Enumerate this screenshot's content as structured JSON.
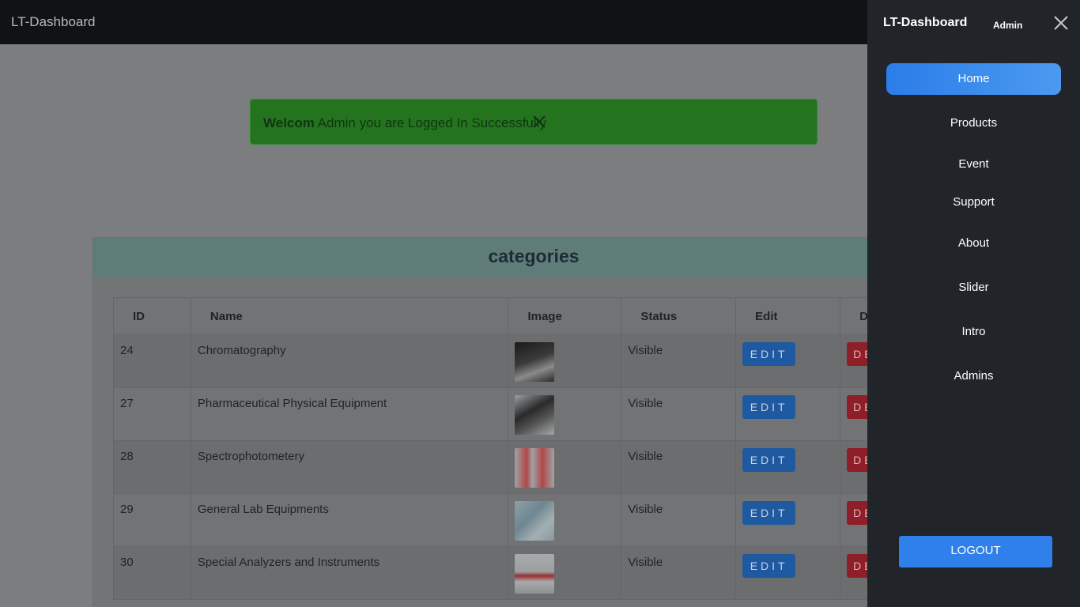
{
  "app": {
    "brand": "LT-Dashboard"
  },
  "alert": {
    "strong": "Welcom",
    "message": " Admin you are Logged In Successfully",
    "close_icon": "close-icon"
  },
  "card": {
    "title": "categories",
    "columns": [
      "ID",
      "Name",
      "Image",
      "Status",
      "Edit",
      "D"
    ],
    "rows": [
      {
        "id": "24",
        "name": "Chromatography",
        "status": "Visible",
        "edit": "EDIT",
        "delete": "DE"
      },
      {
        "id": "27",
        "name": "Pharmaceutical Physical Equipment",
        "status": "Visible",
        "edit": "EDIT",
        "delete": "DE"
      },
      {
        "id": "28",
        "name": "Spectrophotometery",
        "status": "Visible",
        "edit": "EDIT",
        "delete": "DE"
      },
      {
        "id": "29",
        "name": "General Lab Equipments",
        "status": "Visible",
        "edit": "EDIT",
        "delete": "DE"
      },
      {
        "id": "30",
        "name": "Special Analyzers and Instruments",
        "status": "Visible",
        "edit": "EDIT",
        "delete": "DE"
      }
    ]
  },
  "sidebar": {
    "brand": "LT-Dashboard",
    "user": "Admin",
    "items": [
      {
        "label": "Home",
        "active": true
      },
      {
        "label": "Products",
        "active": false
      },
      {
        "label": "Event",
        "active": false
      },
      {
        "label": "Support",
        "active": false
      },
      {
        "label": "About",
        "active": false
      },
      {
        "label": "Slider",
        "active": false
      },
      {
        "label": "Intro",
        "active": false
      },
      {
        "label": "Admins",
        "active": false
      }
    ],
    "logout": "LOGOUT"
  },
  "colors": {
    "accent": "#2f80ea",
    "success": "#24741f",
    "danger": "#8e1e27",
    "sidebar_bg": "#212529"
  }
}
